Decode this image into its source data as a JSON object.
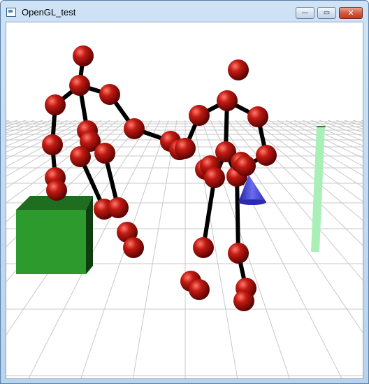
{
  "window": {
    "title": "OpenGL_test",
    "title_icon": "app-window-icon"
  },
  "controls": {
    "minimize_glyph": "—",
    "minimize_icon": "minimize-icon",
    "maximize_glyph": "▭",
    "maximize_icon": "maximize-icon",
    "close_glyph": "✕",
    "close_icon": "close-icon"
  },
  "scene": {
    "background": "#ffffff",
    "grid_color": "#c8c8c8",
    "joint_color": "#a31010",
    "bone_color": "#000000",
    "cube_color": "#2d9a2d",
    "cone_color": "#3a3ad6",
    "pillar_color": "#a8f0b8"
  }
}
